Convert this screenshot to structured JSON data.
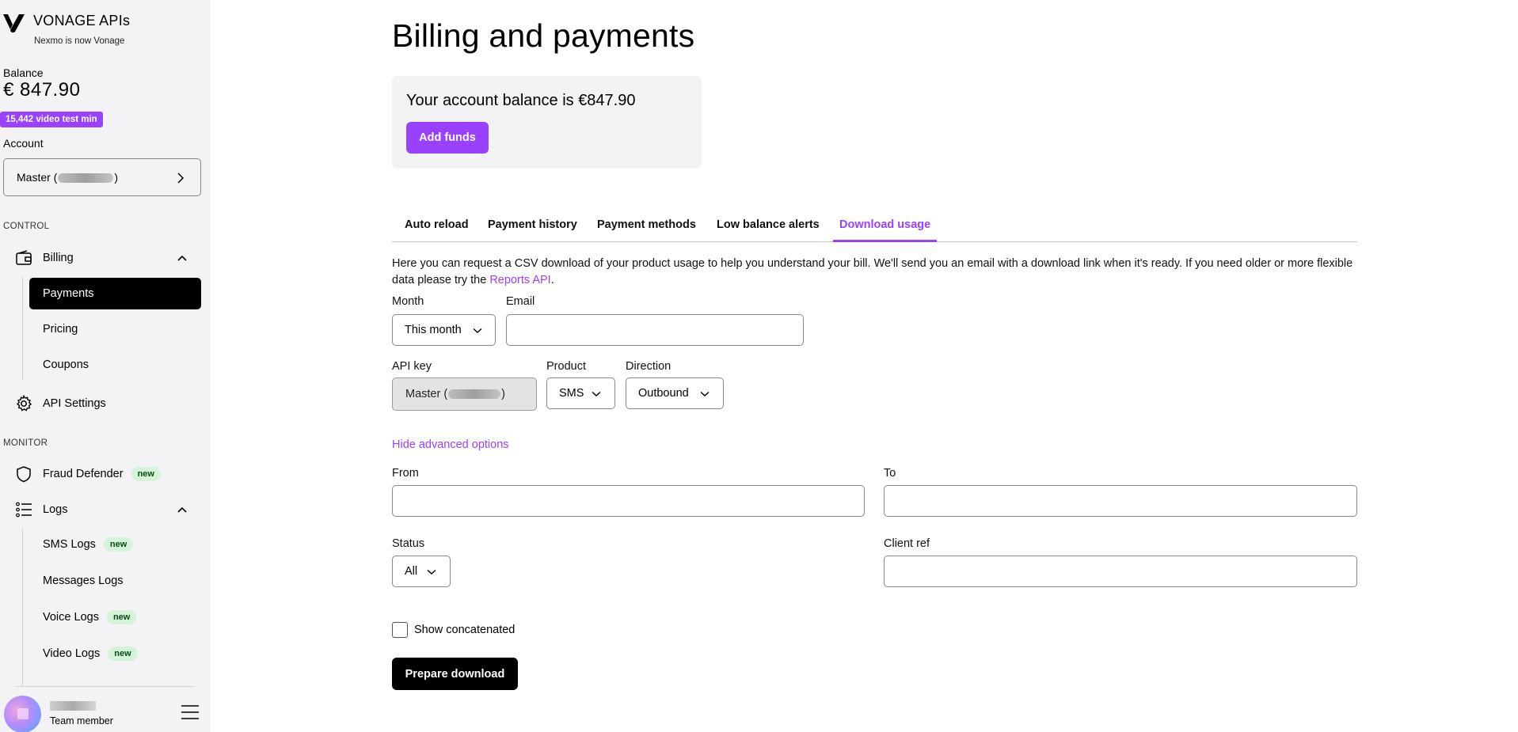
{
  "brand": {
    "name": "VONAGE APIs",
    "subtitle": "Nexmo is now Vonage"
  },
  "sidebar": {
    "balance_label": "Balance",
    "balance_value": "€ 847.90",
    "video_badge": "15,442 video test min",
    "account_label": "Account",
    "account_prefix": "Master (",
    "account_suffix": ")",
    "control_label": "CONTROL",
    "billing_label": "Billing",
    "billing_items": [
      {
        "label": "Payments"
      },
      {
        "label": "Pricing"
      },
      {
        "label": "Coupons"
      }
    ],
    "api_settings_label": "API Settings",
    "monitor_label": "MONITOR",
    "fraud_label": "Fraud Defender",
    "new_badge": "new",
    "logs_label": "Logs",
    "logs_items": [
      {
        "label": "SMS Logs"
      },
      {
        "label": "Messages Logs"
      },
      {
        "label": "Voice Logs"
      },
      {
        "label": "Video Logs"
      }
    ],
    "user_role": "Team member"
  },
  "main": {
    "title": "Billing and payments",
    "balance_text": "Your account balance is €847.90",
    "add_funds": "Add funds",
    "tabs": [
      {
        "label": "Auto reload"
      },
      {
        "label": "Payment history"
      },
      {
        "label": "Payment methods"
      },
      {
        "label": "Low balance alerts"
      },
      {
        "label": "Download usage"
      }
    ],
    "description": "Here you can request a CSV download of your product usage to help you understand your bill. We'll send you an email with a download link when it's ready. If you need older or more flexible data please try the ",
    "reports_link": "Reports API",
    "description_end": ".",
    "form": {
      "month_label": "Month",
      "month_value": "This month",
      "email_label": "Email",
      "email_value": "",
      "api_key_label": "API key",
      "api_key_prefix": "Master (",
      "api_key_suffix": ")",
      "product_label": "Product",
      "product_value": "SMS",
      "direction_label": "Direction",
      "direction_value": "Outbound",
      "advanced_link": "Hide advanced options",
      "from_label": "From",
      "from_value": "",
      "to_label": "To",
      "to_value": "",
      "status_label": "Status",
      "status_value": "All",
      "client_ref_label": "Client ref",
      "client_ref_value": "",
      "show_concat_label": "Show concatenated",
      "prepare_button": "Prepare download"
    }
  },
  "colors": {
    "accent": "#9941ff",
    "sidebar_bg": "#f3f3f5",
    "new_badge_bg": "#d5f3d8"
  }
}
